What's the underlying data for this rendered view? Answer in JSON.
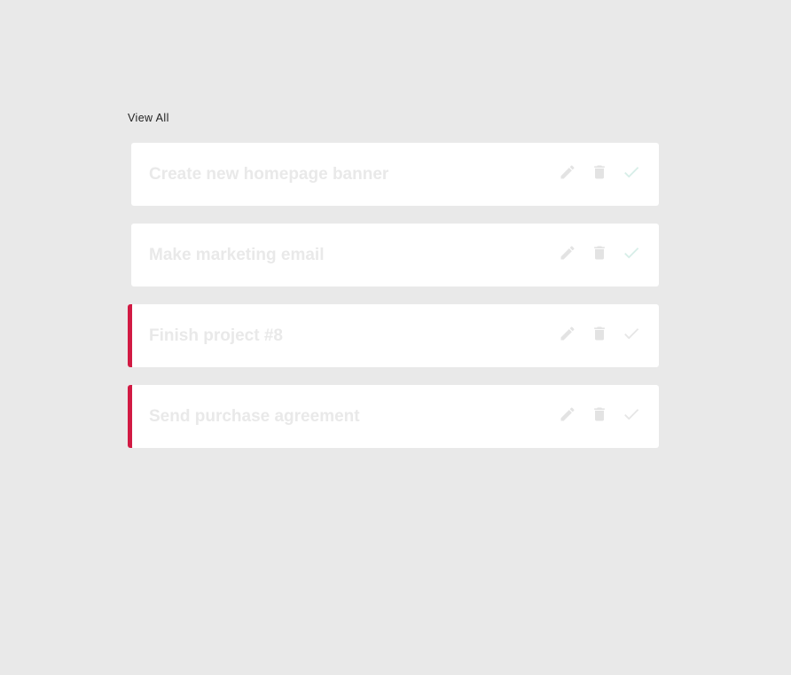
{
  "header": {
    "view_all_label": "View All"
  },
  "todos": [
    {
      "title": "Create new homepage banner",
      "flagged": false,
      "completed": true
    },
    {
      "title": "Make marketing email",
      "flagged": false,
      "completed": true
    },
    {
      "title": "Finish project #8",
      "flagged": true,
      "completed": false
    },
    {
      "title": "Send purchase agreement",
      "flagged": true,
      "completed": false
    }
  ],
  "icons": {
    "edit": "pencil-icon",
    "delete": "trash-icon",
    "complete": "check-icon"
  },
  "colors": {
    "background": "#e9e9e9",
    "card": "#ffffff",
    "title_text": "#e9e9e9",
    "flag_accent": "#d11a43",
    "icon_muted": "#e3e3e3",
    "check_completed": "#d7eee8",
    "check_pending": "#e6e6e6"
  }
}
